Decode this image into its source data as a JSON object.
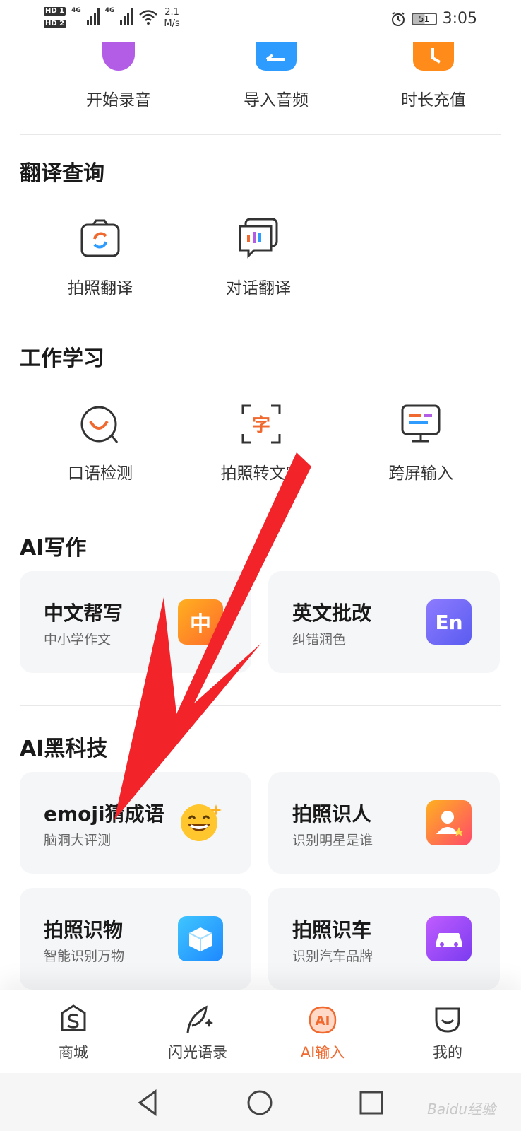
{
  "status_bar": {
    "hd1": "HD 1",
    "hd2": "HD 2",
    "net1": "4G",
    "net2": "4G",
    "speed_value": "2.1",
    "speed_unit": "M/s",
    "battery": "51",
    "time": "3:05"
  },
  "top_row": [
    {
      "label": "开始录音",
      "color": "#b35ce6"
    },
    {
      "label": "导入音频",
      "color": "#2e9bff"
    },
    {
      "label": "时长充值",
      "color": "#ff8c1a"
    }
  ],
  "translate": {
    "title": "翻译查询",
    "tools": [
      {
        "label": "拍照翻译",
        "icon": "photo-translate-icon"
      },
      {
        "label": "对话翻译",
        "icon": "dialog-translate-icon"
      }
    ]
  },
  "work": {
    "title": "工作学习",
    "tools": [
      {
        "label": "口语检测",
        "icon": "speech-check-icon"
      },
      {
        "label": "拍照转文字",
        "icon": "photo-to-text-icon"
      },
      {
        "label": "跨屏输入",
        "icon": "cross-screen-icon"
      }
    ]
  },
  "ai_writing": {
    "title": "AI写作",
    "cards": [
      {
        "title": "中文帮写",
        "sub": "中小学作文",
        "icon_text": "中"
      },
      {
        "title": "英文批改",
        "sub": "纠错润色",
        "icon_text": "En"
      }
    ]
  },
  "ai_tech": {
    "title": "AI黑科技",
    "cards": [
      {
        "title": "emoji猜成语",
        "sub": "脑洞大评测"
      },
      {
        "title": "拍照识人",
        "sub": "识别明星是谁"
      },
      {
        "title": "拍照识物",
        "sub": "智能识别万物"
      },
      {
        "title": "拍照识车",
        "sub": "识别汽车品牌"
      }
    ]
  },
  "bottom_nav": [
    {
      "label": "商城",
      "icon": "store-icon"
    },
    {
      "label": "闪光语录",
      "icon": "feather-icon"
    },
    {
      "label": "AI输入",
      "icon": "ai-input-icon",
      "active": true
    },
    {
      "label": "我的",
      "icon": "profile-icon"
    }
  ],
  "watermark": "Baidu经验",
  "colors": {
    "accent": "#f0692e",
    "arrow": "#f2242a",
    "card_bg": "#f5f6f8"
  }
}
